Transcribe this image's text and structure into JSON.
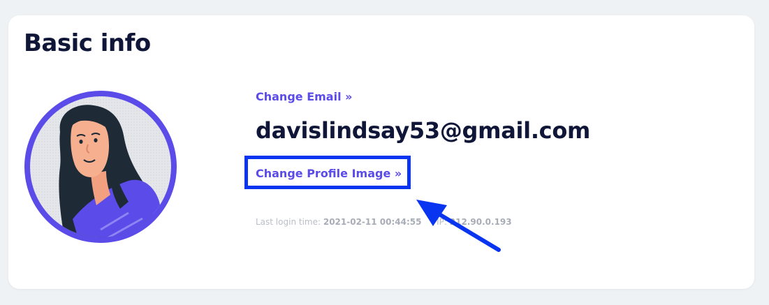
{
  "section": {
    "title": "Basic info"
  },
  "profile": {
    "change_email_label": "Change Email »",
    "email": "davislindsay53@gmail.com",
    "change_image_label": "Change Profile Image »"
  },
  "login_info": {
    "last_login_label": "Last login time:",
    "last_login_value": "2021-02-11 00:44:55",
    "ip_label": "IP:",
    "ip_value": "212.90.0.193"
  },
  "colors": {
    "accent": "#5b4be8",
    "highlight_box": "#0a35f0",
    "title_text": "#0f1637",
    "avatar_ring": "#5b4be8"
  },
  "icons": {
    "avatar": "user-avatar-illustration",
    "annotation": "pointer-arrow-icon"
  }
}
